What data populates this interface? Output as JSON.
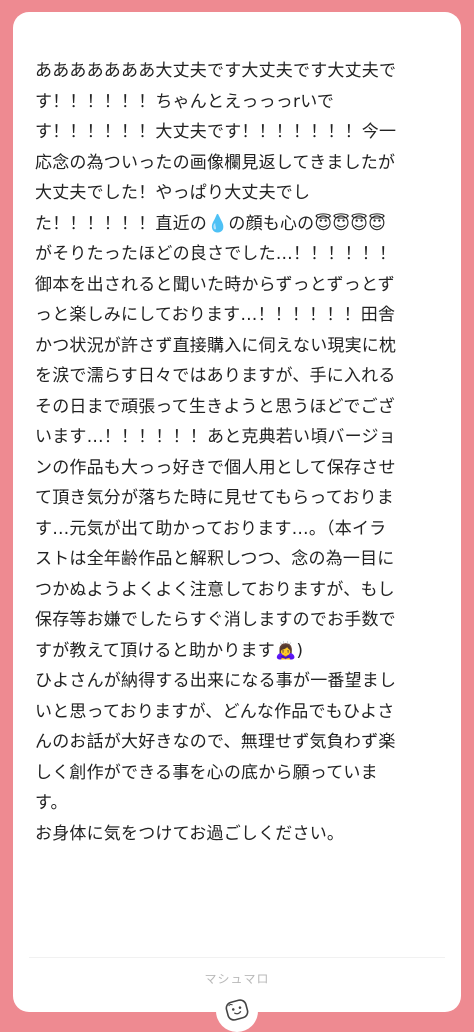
{
  "message": {
    "lines": [
      "あああああああ大丈夫です大丈夫です大丈夫で",
      "す！！！！！！ちゃんとえっっっrいで",
      "す！！！！！！大丈夫です！！！！！！！今一",
      "応念の為ついったの画像欄見返してきましたが",
      "大丈夫でした！やっぱり大丈夫でし",
      "た！！！！！！直近の💧の顔も心の😇😇😇😇",
      "がそりたったほどの良さでした…！！！！！！",
      "御本を出されると聞いた時からずっとずっとず",
      "っと楽しみにしております…！！！！！！田舎",
      "かつ状況が許さず直接購入に伺えない現実に枕",
      "を涙で濡らす日々ではありますが、手に入れる",
      "その日まで頑張って生きようと思うほどでござ",
      "います…！！！！！！あと克典若い頃バージョ",
      "ンの作品も大っっ好きで個人用として保存させ",
      "て頂き気分が落ちた時に見せてもらっておりま",
      "す…元気が出て助かっております…。（本イラ",
      "ストは全年齢作品と解釈しつつ、念の為一目に",
      "つかぬようよくよく注意しておりますが、もし",
      "保存等お嫌でしたらすぐ消しますのでお手数で",
      "すが教えて頂けると助かります🙇‍♀️)",
      "ひよさんが納得する出来になる事が一番望まし",
      "いと思っておりますが、どんな作品でもひよさ",
      "んのお話が大好きなので、無理せず気負わず楽",
      "しく創作ができる事を心の底から願っていま",
      "す。",
      "お身体に気をつけてお過ごしください。"
    ]
  },
  "footer": {
    "brand": "マシュマロ"
  },
  "badge": {
    "icon": "marshmallow-face-icon"
  },
  "colors": {
    "background": "#ee8a91",
    "card": "#ffffff",
    "text": "#222222",
    "footer_text": "#b8b8b8"
  }
}
